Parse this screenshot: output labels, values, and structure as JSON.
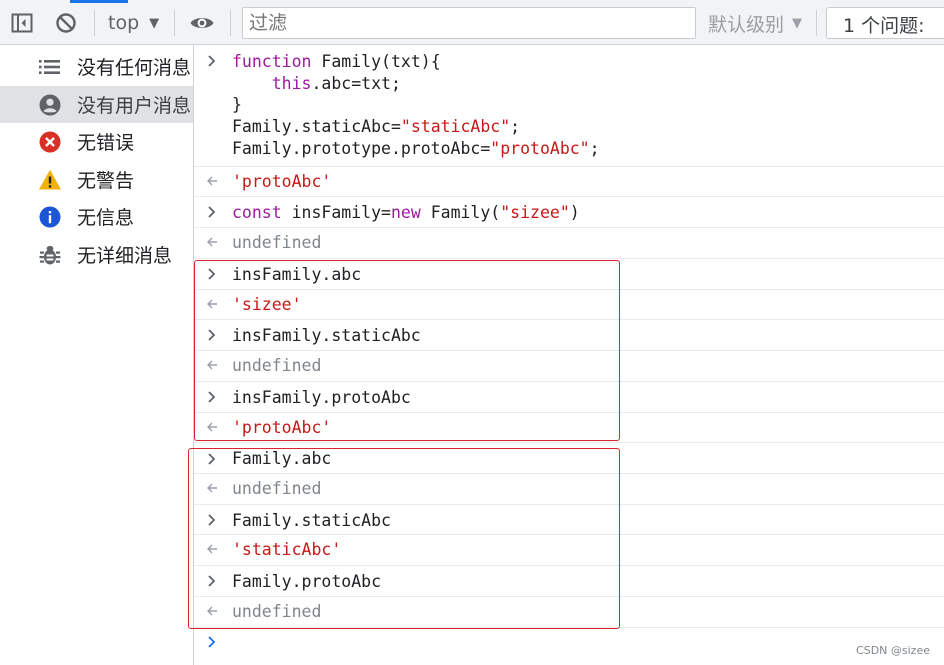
{
  "toolbar": {
    "context_label": "top",
    "filter_placeholder": "过滤",
    "levels_label": "默认级别",
    "issues_label": "1 个问题: "
  },
  "sidebar": {
    "items": [
      {
        "label": "没有任何消息",
        "icon": "list-icon"
      },
      {
        "label": "没有用户消息",
        "icon": "user-icon"
      },
      {
        "label": "无错误",
        "icon": "error-icon"
      },
      {
        "label": "无警告",
        "icon": "warning-icon"
      },
      {
        "label": "无信息",
        "icon": "info-icon"
      },
      {
        "label": "无详细消息",
        "icon": "bug-icon"
      }
    ]
  },
  "console": {
    "entries": [
      {
        "type": "input",
        "lines": [
          "function Family(txt){",
          "    this.abc=txt;",
          "}",
          "Family.staticAbc=\"staticAbc\";",
          "Family.prototype.protoAbc=\"protoAbc\";"
        ]
      },
      {
        "type": "output",
        "text": "'protoAbc'"
      },
      {
        "type": "input",
        "text": "const insFamily=new Family(\"sizee\")"
      },
      {
        "type": "output",
        "text": "undefined"
      },
      {
        "type": "input",
        "text": "insFamily.abc"
      },
      {
        "type": "output",
        "text": "'sizee'"
      },
      {
        "type": "input",
        "text": "insFamily.staticAbc"
      },
      {
        "type": "output",
        "text": "undefined"
      },
      {
        "type": "input",
        "text": "insFamily.protoAbc"
      },
      {
        "type": "output",
        "text": "'protoAbc'"
      },
      {
        "type": "input",
        "text": "Family.abc"
      },
      {
        "type": "output",
        "text": "undefined"
      },
      {
        "type": "input",
        "text": "Family.staticAbc"
      },
      {
        "type": "output",
        "text": "'staticAbc'"
      },
      {
        "type": "input",
        "text": "Family.protoAbc"
      },
      {
        "type": "output",
        "text": "undefined"
      }
    ]
  },
  "watermark": "CSDN @sizee",
  "colors": {
    "keyword": "#9c1a9e",
    "string": "#c41a16",
    "undefined": "#80868b",
    "highlight_box": "#d9262e",
    "accent": "#1a73e8"
  }
}
